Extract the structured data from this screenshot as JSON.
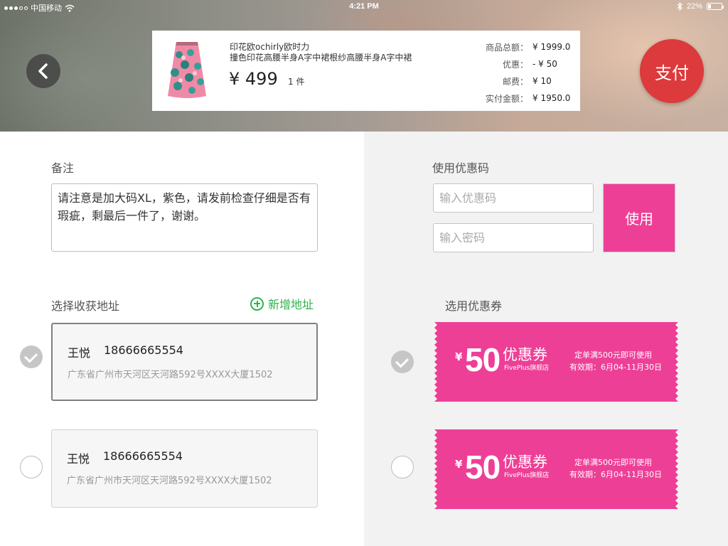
{
  "status_bar": {
    "carrier": "中国移动",
    "time": "4:21 PM",
    "battery": "22%",
    "battery_level": 0.22,
    "icons": [
      "signal-dots",
      "wifi-icon",
      "bluetooth-icon",
      "battery-icon"
    ]
  },
  "header": {
    "back_icon": "chevron-left-icon",
    "pay_label": "支付",
    "pay_color": "#dc3a3c"
  },
  "order": {
    "title_line1": "印花欧ochirly欧时力",
    "title_line2": "撞色印花高腰半身A字中裙根纱高腰半身A字中裙",
    "price": "¥ 499",
    "quantity": "1 件",
    "summary": [
      {
        "label": "商品总额：",
        "value": "¥ 1999.0"
      },
      {
        "label": "优惠：",
        "value": "- ¥ 50"
      },
      {
        "label": "邮费：",
        "value": "¥ 10"
      },
      {
        "label": "实付金额：",
        "value": "¥ 1950.0"
      }
    ]
  },
  "remark": {
    "label": "备注",
    "text": "请注意是加大码XL，紫色，请发前检查仔细是否有瑕疵，剩最后一件了，谢谢。"
  },
  "address": {
    "label": "选择收获地址",
    "add_label": "新增地址",
    "add_color": "#2db34a",
    "items": [
      {
        "name": "王悦",
        "phone": "18666665554",
        "detail": "广东省广州市天河区天河路592号XXXX大厦1502",
        "selected": true
      },
      {
        "name": "王悦",
        "phone": "18666665554",
        "detail": "广东省广州市天河区天河路592号XXXX大厦1502",
        "selected": false
      }
    ]
  },
  "promo_code": {
    "label": "使用优惠码",
    "code_placeholder": "输入优惠码",
    "password_placeholder": "输入密码",
    "use_label": "使用",
    "use_color": "#ee3f97"
  },
  "coupons": {
    "label": "选用优惠券",
    "color": "#ee3f97",
    "items": [
      {
        "currency": "¥",
        "amount": "50",
        "type": "优惠券",
        "shop": "FivePlus旗舰店",
        "condition": "定单满500元即可使用",
        "validity": "有效期：6月04-11月30日",
        "selected": true
      },
      {
        "currency": "¥",
        "amount": "50",
        "type": "优惠券",
        "shop": "FivePlus旗舰店",
        "condition": "定单满500元即可使用",
        "validity": "有效期：6月04-11月30日",
        "selected": false
      }
    ]
  }
}
